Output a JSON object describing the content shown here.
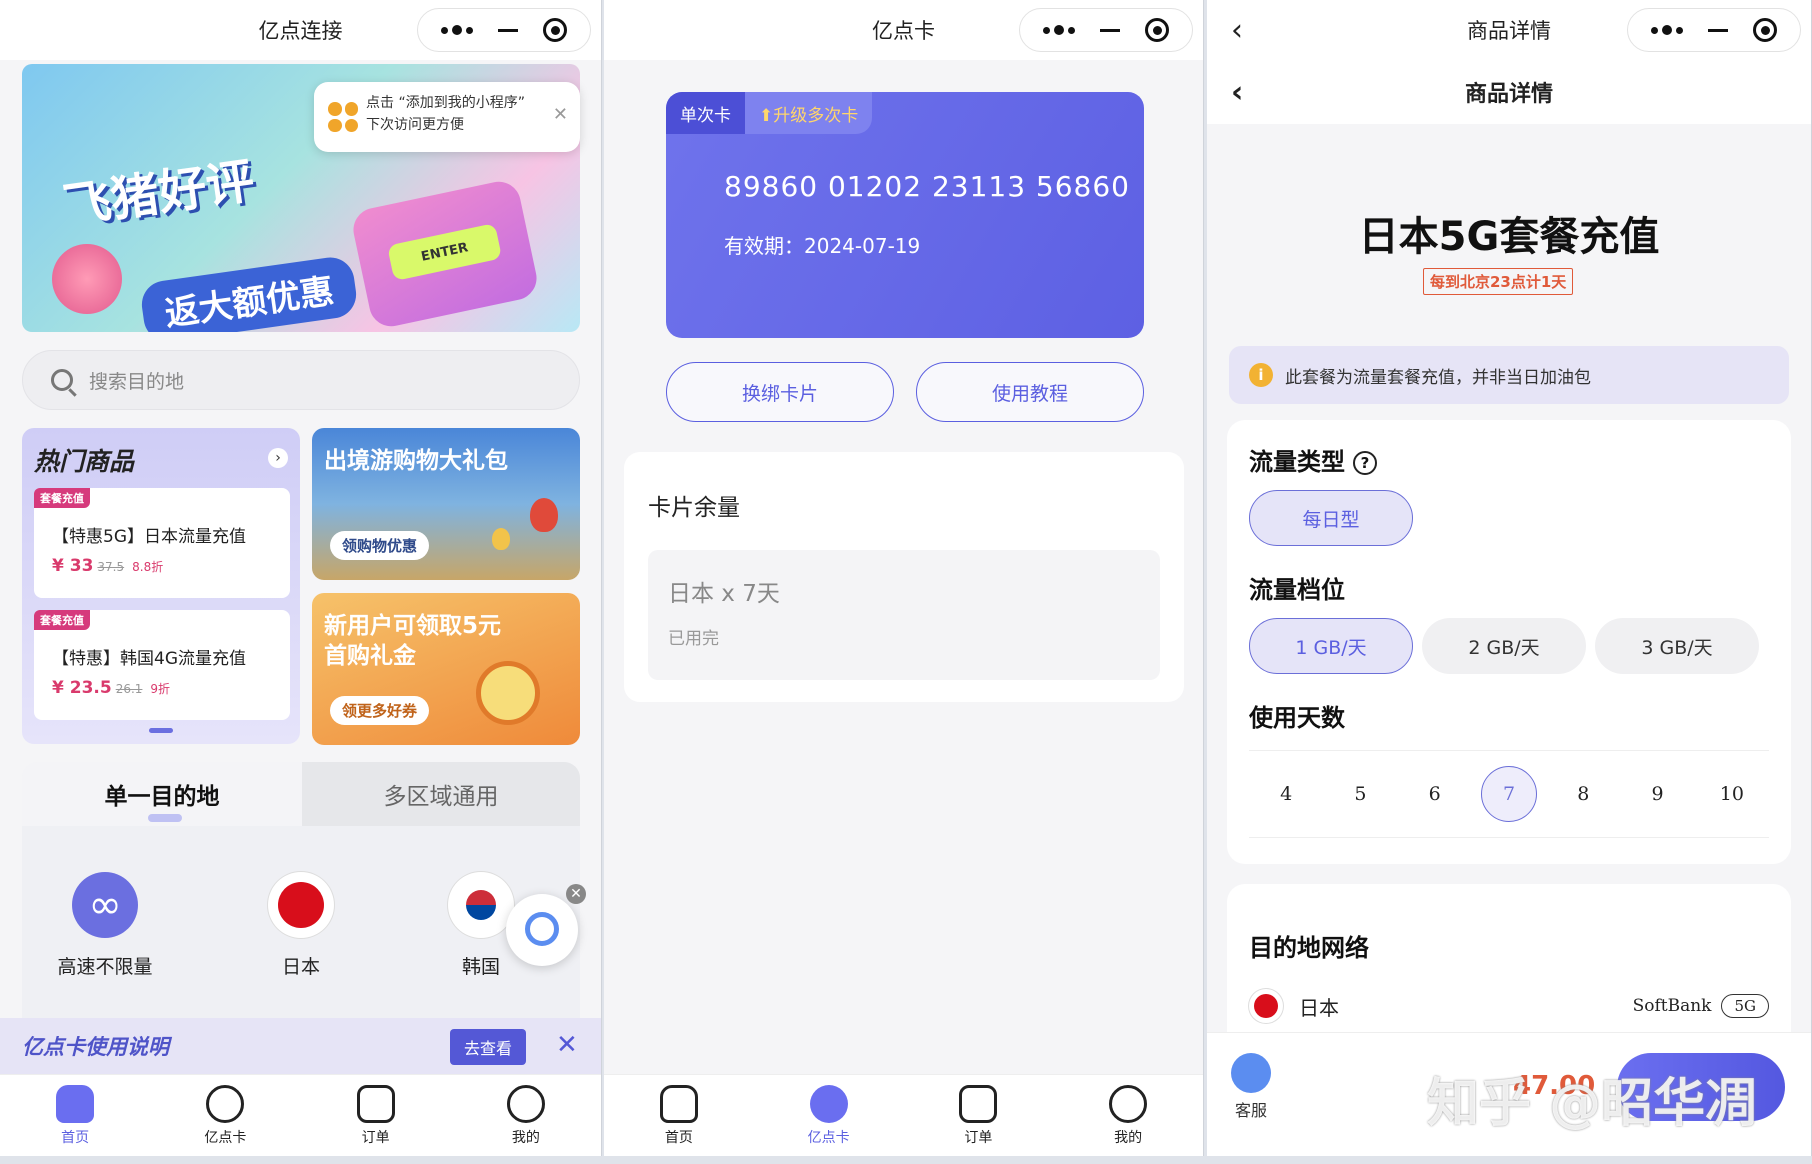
{
  "p1": {
    "title": "亿点连接",
    "tip": {
      "line1": "点击 “添加到我的小程序”",
      "line2": "下次访问更方便"
    },
    "banner": {
      "title": "飞猪好评",
      "sub": "返大额优惠",
      "key": "ENTER"
    },
    "search_placeholder": "搜索目的地",
    "hot": {
      "title": "热门商品",
      "items": [
        {
          "tag": "套餐充值",
          "name": "【特惠5G】日本流量充值",
          "price": "¥ 33",
          "old": "37.5",
          "disc": "8.8折"
        },
        {
          "tag": "套餐充值",
          "name": "【特惠】韩国4G流量充值",
          "price": "¥ 23.5",
          "old": "26.1",
          "disc": "9折"
        }
      ]
    },
    "promo1": {
      "title": "出境游购物大礼包",
      "btn": "领购物优惠"
    },
    "promo2": {
      "title": "新用户可领取5元 首购礼金",
      "btn": "领更多好券"
    },
    "tabs": [
      "单一目的地",
      "多区域通用"
    ],
    "destinations": [
      "高速不限量",
      "日本",
      "韩国"
    ],
    "guide": {
      "text": "亿点卡使用说明",
      "btn": "去查看"
    },
    "tabbar": [
      "首页",
      "亿点卡",
      "订单",
      "我的"
    ]
  },
  "p2": {
    "title": "亿点卡",
    "card": {
      "tag1": "单次卡",
      "tag2": "升级多次卡",
      "number": "89860 01202 23113 56860",
      "expiry": "有效期：2024-07-19"
    },
    "buttons": [
      "换绑卡片",
      "使用教程"
    ],
    "balance": {
      "title": "卡片余量",
      "name": "日本 x 7天",
      "status": "已用完"
    },
    "tabbar": [
      "首页",
      "亿点卡",
      "订单",
      "我的"
    ]
  },
  "p3": {
    "title": "商品详情",
    "subtitle": "商品详情",
    "product": "日本5G套餐充值",
    "badge": "每到北京23点计1天",
    "notice": "此套餐为流量套餐充值，并非当日加油包",
    "flow_type": {
      "label": "流量类型",
      "help": "?",
      "options": [
        "每日型"
      ]
    },
    "flow_level": {
      "label": "流量档位",
      "options": [
        "1 GB/天",
        "2 GB/天",
        "3 GB/天"
      ]
    },
    "days": {
      "label": "使用天数",
      "options": [
        "4",
        "5",
        "6",
        "7",
        "8",
        "9",
        "10"
      ]
    },
    "network": {
      "label": "目的地网络",
      "country": "日本",
      "operator": "SoftBank",
      "gen": "5G"
    },
    "service": "客服",
    "price": "47.00",
    "watermark": "知乎 @昭华凋"
  },
  "colors": {
    "accent": "#5b5fe0",
    "card": "#6a6ef0",
    "price": "#d93a6c"
  }
}
